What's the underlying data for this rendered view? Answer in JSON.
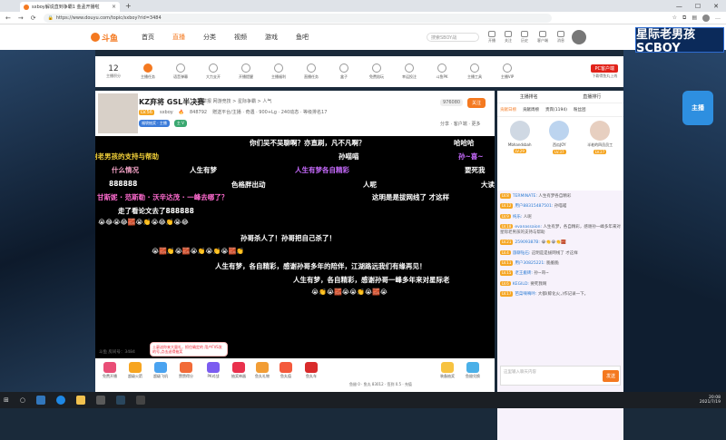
{
  "browser": {
    "tab_title": "sxboy解说直到争霸1 金孟开播啦",
    "url": "https://www.douyu.com/topic/sxboy?rid=3484"
  },
  "site_header": {
    "logo_text": "斗鱼",
    "nav": [
      "首页",
      "直播",
      "分类",
      "视频",
      "游戏",
      "鱼吧"
    ],
    "search_placeholder": "搜索SBOY战",
    "icons": [
      {
        "name": "live-icon",
        "label": "开播"
      },
      {
        "name": "follow-icon",
        "label": "关注"
      },
      {
        "name": "history-icon",
        "label": "历史"
      },
      {
        "name": "client-icon",
        "label": "客户端"
      },
      {
        "name": "message-icon",
        "label": "消息"
      }
    ]
  },
  "banner_text": "星际老男孩 SCBOY",
  "toolbar": {
    "level_number": "12",
    "level_label": "主播积分",
    "items": [
      "主播任务",
      "语音弹幕",
      "大力支开",
      "开播提醒",
      "主播福利",
      "直播任务",
      "盒子",
      "免费陪玩",
      "幸运投注",
      "斗鱼PK",
      "主播工具",
      "主播VIP"
    ],
    "pc_button": "PC客户端",
    "pc_sub": "下载得鱼丸上线"
  },
  "room": {
    "title": "KZ弃将 GSL半决赛",
    "tags": "举报 网游竞技 > 星际争霸 > 人气",
    "anchor_level": "LV.56",
    "anchor_name": "sxboy",
    "stats": "848792",
    "info": "赠送平台/主播 · 奇遇 · 900+Lg · 240动态 · 等级排名17",
    "pill1": "福袋抽奖 · 主播",
    "pill2": "主 V",
    "follow_count": "976080",
    "follow_label": "关注",
    "share": "分享 · 客户端 · 更多"
  },
  "danmaku": [
    {
      "text": "你们吴不吴聊啊？亦直刷，凡不凡啊？",
      "color": "#ffffff"
    },
    {
      "text": "哈哈哈",
      "color": "#ffffff"
    },
    {
      "text": "谢老男孩的支持与帮助",
      "color": "#f5d33a"
    },
    {
      "text": "孙喵喵",
      "color": "#ffffff"
    },
    {
      "text": "孙~喜~",
      "color": "#c86bff"
    },
    {
      "text": "什么情况",
      "color": "#f5a3c7"
    },
    {
      "text": "人生有梦",
      "color": "#ffffff"
    },
    {
      "text": "人生有梦各自精彩",
      "color": "#c86bff"
    },
    {
      "text": "要死我",
      "color": "#ffffff"
    },
    {
      "text": "888888",
      "color": "#ffffff"
    },
    {
      "text": "色格胖出动",
      "color": "#ffffff"
    },
    {
      "text": "人呢",
      "color": "#ffffff"
    },
    {
      "text": "大读",
      "color": "#ffffff"
    },
    {
      "text": "甘斯妮 · 范斯勒 · 沃辛达茂 · 一峰去哪了？",
      "color": "#ff6bd0"
    },
    {
      "text": "这明是是拔网线了 才这样",
      "color": "#ffffff"
    },
    {
      "text": "走了看论文去了888888",
      "color": "#ffffff"
    },
    {
      "text": "😭😂😭😂🧱😭👏😭😂👏😭😂",
      "color": "#ffffff"
    },
    {
      "text": "孙哥杀人了！孙哥把自己杀了！",
      "color": "#ffffff"
    },
    {
      "text": "😭🧱👏😭🧱😭👏😭👏😭🧱👏",
      "color": "#ffffff"
    },
    {
      "text": "人生有梦，各自精彩，感谢孙哥多年的陪伴，江湖路远我们有缘再见！",
      "color": "#ffffff"
    },
    {
      "text": "人生有梦，各自精彩，感谢孙哥一峰多年来对星际老",
      "color": "#ffffff"
    },
    {
      "text": "😭👏😭🧱😭😭👏😭🧱😭",
      "color": "#ffffff"
    }
  ],
  "video_bottom": "斗鱼 房间号：3484",
  "popup": "土豪送你来大量礼，抓住确定的 用户FVS发的号,点击送得抽奖",
  "gifts": [
    "免费开播",
    "超级火箭",
    "超级飞机",
    "赞赞得分",
    "PK对战",
    "抽奖神器",
    "鱼丸礼物",
    "鱼丸值",
    "鱼丸车"
  ],
  "gift_bar_info": "鱼翅 0 · 鱼丸 83012 · 签到 0.5 · 充值",
  "gift_right": [
    "装备抽奖",
    "鱼翅兑换"
  ],
  "sidebar": {
    "top_left": "主播排名",
    "top_right": "直播排行",
    "tabs": [
      "贡献日榜",
      "贡献周榜",
      "贵宾(1194)",
      "粉丝团"
    ],
    "ranks": [
      {
        "name": "Mbhandsbah",
        "lv": "LV.29"
      },
      {
        "name": "西瓜JOY",
        "lv": "LV.37"
      },
      {
        "name": "半老的四员员工",
        "lv": "LV.27"
      }
    ],
    "messages": [
      {
        "lv": "LV.8",
        "name": "TERMINATE:",
        "text": "人生有梦各自精彩"
      },
      {
        "lv": "LV.12",
        "name": "用户88315487501:",
        "text": "孙喵喵"
      },
      {
        "lv": "LV.9",
        "name": "纯乐:",
        "text": "人呢"
      },
      {
        "lv": "LV.18",
        "name": "evanassaion:",
        "text": "人生有梦，各自精彩，感谢孙一峰多年来对星际老男孩的支持与帮助"
      },
      {
        "lv": "LV.21",
        "name": "25909387B:",
        "text": "😭👏😭👏🧱"
      },
      {
        "lv": "LV.4",
        "name": "旅聊钻石:",
        "text": "这明是是拔网线了 才这样"
      },
      {
        "lv": "LV.11",
        "name": "用户30825221:",
        "text": "脆脆脆"
      },
      {
        "lv": "LV.15",
        "name": "老王搬砖:",
        "text": "孙~哥~"
      },
      {
        "lv": "LV.6",
        "name": "KEGILD:",
        "text": "要死我啊"
      },
      {
        "lv": "LV.17",
        "name": "芭菜嘀嘀吟:",
        "text": "大都(鲸化火，)作记录一下。"
      }
    ],
    "input_placeholder": "这里输入聊天内容",
    "send": "发送"
  },
  "robot_text": "主播",
  "taskbar": {
    "time": "20:08",
    "date": "2021/7/19"
  }
}
